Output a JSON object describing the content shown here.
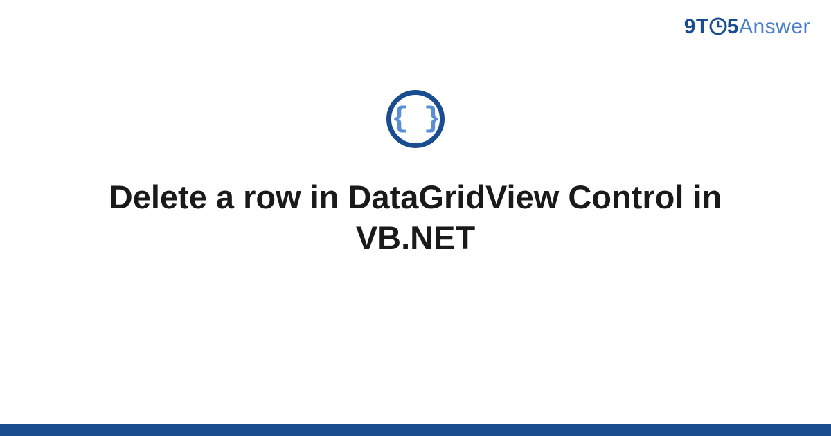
{
  "logo": {
    "part1": "9T",
    "part2": "5",
    "part3": "Answer"
  },
  "icon": {
    "braces": "{ }",
    "name": "code-braces-icon"
  },
  "title": "Delete a row in DataGridView Control in VB.NET",
  "colors": {
    "dark_blue": "#1a4d8f",
    "light_blue": "#5a8fd4",
    "text": "#1a1a1a"
  }
}
